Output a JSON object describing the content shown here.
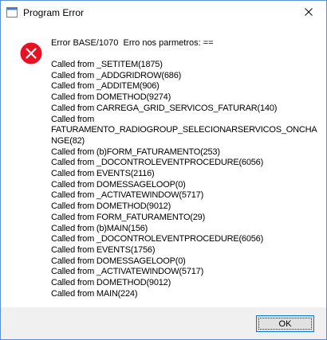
{
  "window": {
    "title": "Program Error"
  },
  "message": {
    "header": "Error BASE/1070  Erro nos parmetros: ==",
    "lines": [
      "Called from _SETITEM(1875)",
      "Called from _ADDGRIDROW(686)",
      "Called from _ADDITEM(906)",
      "Called from DOMETHOD(9274)",
      "Called from CARREGA_GRID_SERVICOS_FATURAR(140)",
      "Called from",
      "FATURAMENTO_RADIOGROUP_SELECIONARSERVICOS_ONCHA",
      "NGE(82)",
      "Called from (b)FORM_FATURAMENTO(253)",
      "Called from _DOCONTROLEVENTPROCEDURE(6056)",
      "Called from EVENTS(2116)",
      "Called from DOMESSAGELOOP(0)",
      "Called from _ACTIVATEWINDOW(5717)",
      "Called from DOMETHOD(9012)",
      "Called from FORM_FATURAMENTO(29)",
      "Called from (b)MAIN(156)",
      "Called from _DOCONTROLEVENTPROCEDURE(6056)",
      "Called from EVENTS(1756)",
      "Called from DOMESSAGELOOP(0)",
      "Called from _ACTIVATEWINDOW(5717)",
      "Called from DOMETHOD(9012)",
      "Called from MAIN(224)"
    ]
  },
  "buttons": {
    "ok_label": "OK"
  },
  "icons": {
    "app": "window-app-icon",
    "error": "error-icon",
    "close": "close-icon"
  },
  "colors": {
    "error_red": "#e81123",
    "focus_border": "#0078d7",
    "footer_bg": "#f0f0f0"
  }
}
